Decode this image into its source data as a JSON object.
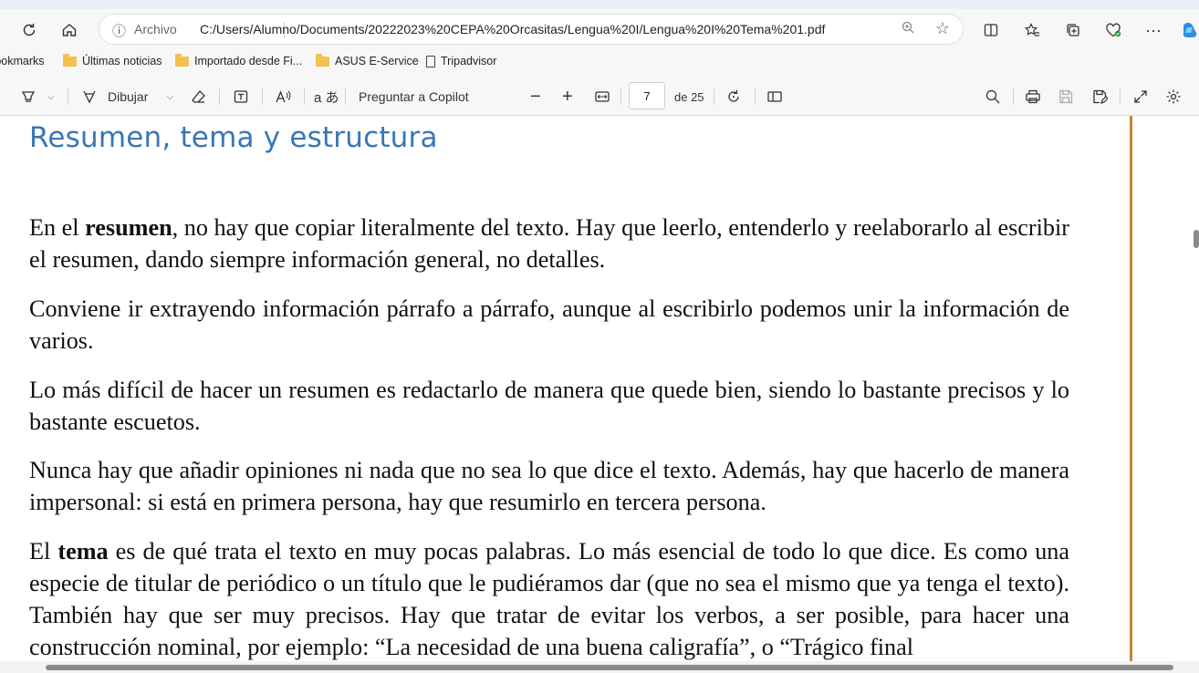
{
  "address_bar": {
    "site_label": "Archivo",
    "url": "C:/Users/Alumno/Documents/20222023%20CEPA%20Orcasitas/Lengua%20I/Lengua%20I%20Tema%201.pdf"
  },
  "bookmarks": [
    {
      "label": "Bookmarks",
      "icon": "none"
    },
    {
      "label": "Últimas noticias",
      "icon": "folder-icon"
    },
    {
      "label": "Importado desde Fi...",
      "icon": "folder-icon"
    },
    {
      "label": "ASUS E-Service",
      "icon": "folder-icon"
    },
    {
      "label": "Tripadvisor",
      "icon": "page-icon"
    }
  ],
  "pdf_toolbar": {
    "draw_label": "Dibujar",
    "copilot_label": "Preguntar a Copilot",
    "current_page": "7",
    "total_pages_label": "de 25"
  },
  "document": {
    "heading": "Resumen, tema y estructura",
    "p1": {
      "pre": "En el ",
      "bold": "resumen",
      "post": ", no hay que copiar literalmente del texto. Hay que leerlo, entenderlo y reelaborarlo al escribir el resumen, dando siempre información general, no detalles."
    },
    "p2": "Conviene ir extrayendo información párrafo a párrafo, aunque al escribirlo podemos unir la información de varios.",
    "p3": "Lo más difícil de hacer un resumen es redactarlo de manera que quede bien, siendo lo bastante precisos y lo bastante escuetos.",
    "p4": "Nunca hay que añadir opiniones ni nada que no sea lo que dice el texto. Además, hay que hacerlo de manera impersonal: si está en primera persona, hay que resumirlo en tercera persona.",
    "p5": {
      "pre": "El ",
      "bold": "tema",
      "post": " es de qué trata el texto en muy pocas palabras. Lo más esencial de todo lo que dice. Es como una especie de titular de periódico o un título que le pudiéramos dar (que no sea el mismo que ya tenga el texto). También hay que ser muy precisos. Hay que tratar de evitar los verbos, a ser posible, para hacer una construcción nominal, por ejemplo: “La necesidad de una buena caligrafía”, o “Trágico final"
    }
  },
  "colors": {
    "heading": "#3a76b5",
    "page_border": "#c9822f",
    "folder": "#f2c14e"
  }
}
